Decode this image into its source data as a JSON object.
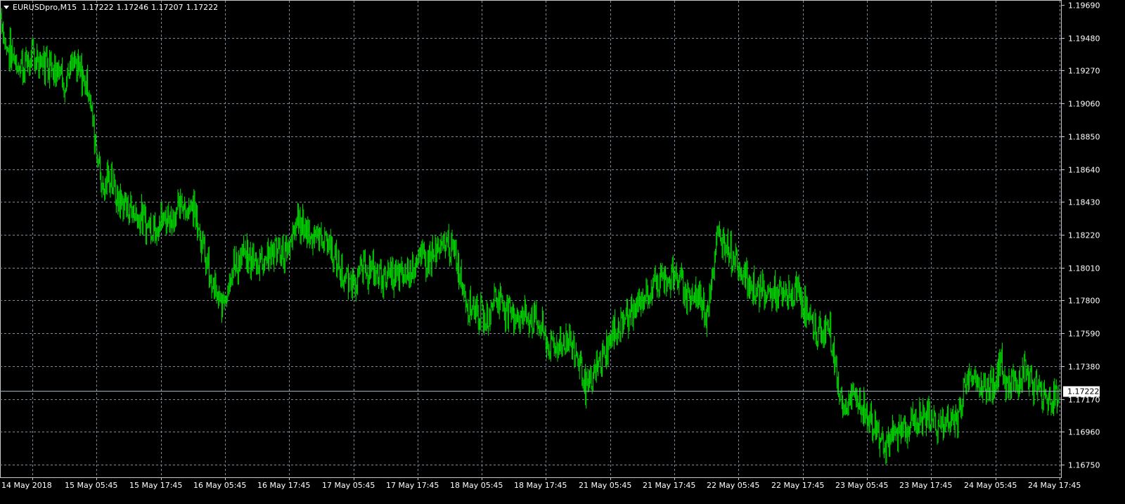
{
  "header": {
    "symbol": "EURUSDpro,M15",
    "open": "1.17222",
    "high": "1.17246",
    "low": "1.17207",
    "close": "1.17222"
  },
  "price_axis": {
    "ticks": [
      "1.19690",
      "1.19480",
      "1.19270",
      "1.19060",
      "1.18850",
      "1.18640",
      "1.18430",
      "1.18220",
      "1.18010",
      "1.17800",
      "1.17590",
      "1.17380",
      "1.17170",
      "1.16960",
      "1.16750"
    ],
    "current_price": "1.17222"
  },
  "time_axis": {
    "ticks": [
      "14 May 2018",
      "15 May 05:45",
      "15 May 17:45",
      "16 May 05:45",
      "16 May 17:45",
      "17 May 05:45",
      "17 May 17:45",
      "18 May 05:45",
      "18 May 17:45",
      "21 May 05:45",
      "21 May 17:45",
      "22 May 05:45",
      "22 May 17:45",
      "23 May 05:45",
      "23 May 17:45",
      "24 May 05:45",
      "24 May 17:45"
    ]
  },
  "colors": {
    "background": "#000000",
    "grid": "#7a8a99",
    "candle": "#00e000",
    "price_line": "#a0b0c0",
    "text": "#ffffff"
  },
  "chart_data": {
    "type": "line",
    "symbol": "EURUSDpro",
    "timeframe": "M15",
    "ylim": [
      1.1667,
      1.1971
    ],
    "current_price": 1.17222,
    "x": [
      "14 May 2018",
      "15 May 05:45",
      "15 May 17:45",
      "16 May 05:45",
      "16 May 17:45",
      "17 May 05:45",
      "17 May 17:45",
      "18 May 05:45",
      "18 May 17:45",
      "21 May 05:45",
      "21 May 17:45",
      "22 May 05:45",
      "22 May 17:45",
      "23 May 05:45",
      "23 May 17:45",
      "24 May 05:45",
      "24 May 17:45"
    ],
    "anchors": [
      [
        0,
        1.1962
      ],
      [
        0.04,
        1.1945
      ],
      [
        0.28,
        1.193
      ],
      [
        0.5,
        1.1935
      ],
      [
        0.9,
        1.193
      ],
      [
        1.0,
        1.192
      ],
      [
        1.12,
        1.193
      ],
      [
        1.35,
        1.192
      ],
      [
        1.45,
        1.189
      ],
      [
        1.6,
        1.185
      ],
      [
        1.72,
        1.186
      ],
      [
        1.8,
        1.1845
      ],
      [
        2.0,
        1.184
      ],
      [
        2.3,
        1.1828
      ],
      [
        2.5,
        1.183
      ],
      [
        2.85,
        1.184
      ],
      [
        3.05,
        1.184
      ],
      [
        3.15,
        1.1815
      ],
      [
        3.3,
        1.179
      ],
      [
        3.45,
        1.1775
      ],
      [
        3.6,
        1.18
      ],
      [
        3.8,
        1.1808
      ],
      [
        4.0,
        1.1805
      ],
      [
        4.3,
        1.1812
      ],
      [
        4.5,
        1.181
      ],
      [
        4.65,
        1.1832
      ],
      [
        4.95,
        1.182
      ],
      [
        5.1,
        1.182
      ],
      [
        5.3,
        1.18
      ],
      [
        5.45,
        1.179
      ],
      [
        5.7,
        1.18
      ],
      [
        6.0,
        1.1795
      ],
      [
        6.3,
        1.1795
      ],
      [
        6.5,
        1.1805
      ],
      [
        6.85,
        1.181
      ],
      [
        7.0,
        1.1818
      ],
      [
        7.15,
        1.1805
      ],
      [
        7.3,
        1.178
      ],
      [
        7.45,
        1.1775
      ],
      [
        7.6,
        1.1765
      ],
      [
        7.75,
        1.1785
      ],
      [
        8.0,
        1.1772
      ],
      [
        8.4,
        1.1768
      ],
      [
        8.6,
        1.175
      ],
      [
        8.9,
        1.1755
      ],
      [
        9.05,
        1.1745
      ],
      [
        9.2,
        1.1722
      ],
      [
        9.45,
        1.1745
      ],
      [
        9.6,
        1.1758
      ],
      [
        9.8,
        1.177
      ],
      [
        10.0,
        1.1775
      ],
      [
        10.15,
        1.1785
      ],
      [
        10.4,
        1.1795
      ],
      [
        10.6,
        1.1795
      ],
      [
        10.75,
        1.1785
      ],
      [
        11.0,
        1.1782
      ],
      [
        11.05,
        1.177
      ],
      [
        11.2,
        1.1805
      ],
      [
        11.25,
        1.1822
      ],
      [
        11.4,
        1.1815
      ],
      [
        11.55,
        1.1805
      ],
      [
        11.75,
        1.179
      ],
      [
        12.0,
        1.1785
      ],
      [
        12.3,
        1.1782
      ],
      [
        12.55,
        1.1785
      ],
      [
        12.65,
        1.177
      ],
      [
        12.8,
        1.176
      ],
      [
        13.0,
        1.1762
      ],
      [
        13.1,
        1.1735
      ],
      [
        13.2,
        1.171
      ],
      [
        13.4,
        1.1718
      ],
      [
        13.6,
        1.1705
      ],
      [
        13.75,
        1.1695
      ],
      [
        13.9,
        1.1688
      ],
      [
        14.2,
        1.17
      ],
      [
        14.5,
        1.1705
      ],
      [
        14.8,
        1.17
      ],
      [
        15.0,
        1.1705
      ],
      [
        15.1,
        1.1722
      ],
      [
        15.25,
        1.1735
      ],
      [
        15.4,
        1.1722
      ],
      [
        15.6,
        1.173
      ],
      [
        15.7,
        1.1738
      ],
      [
        15.8,
        1.1725
      ],
      [
        15.95,
        1.1728
      ],
      [
        16.05,
        1.1738
      ],
      [
        16.2,
        1.1725
      ],
      [
        16.45,
        1.1718
      ],
      [
        16.65,
        1.1722
      ]
    ]
  }
}
